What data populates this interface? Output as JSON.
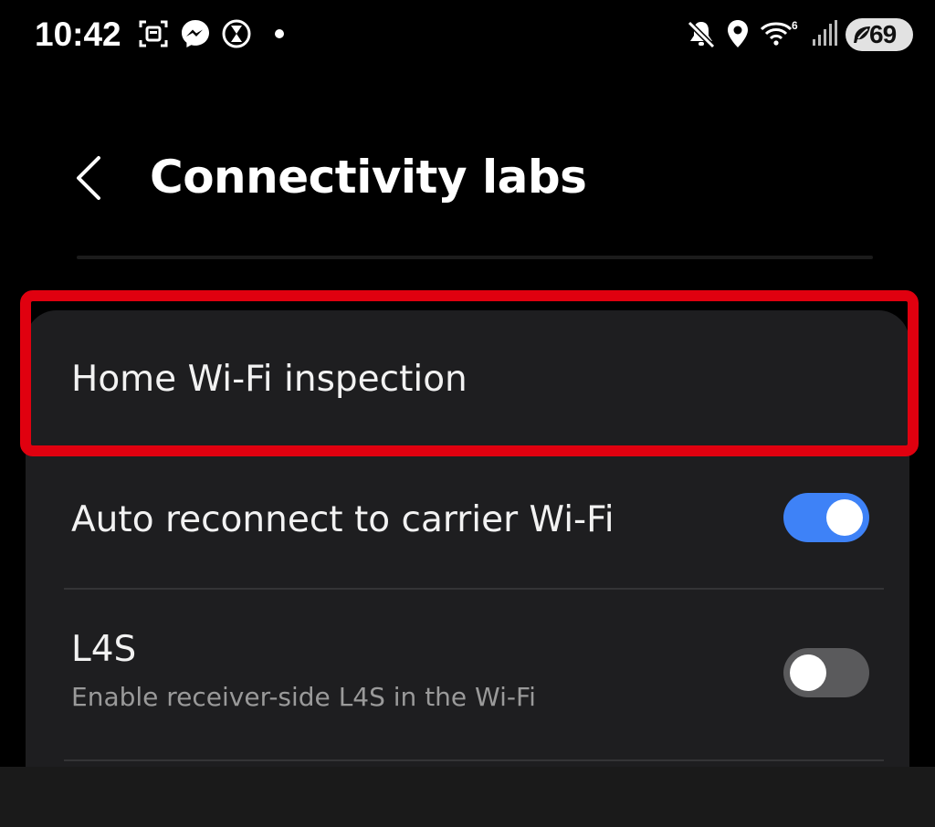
{
  "status_bar": {
    "time": "10:42",
    "icons": [
      "screenshot-icon",
      "messenger-icon",
      "timer-icon",
      "notification-dot",
      "mute-icon",
      "location-icon",
      "wifi-icon",
      "signal-icon",
      "battery-saver-icon"
    ],
    "battery_level": "69"
  },
  "header": {
    "back_icon": "chevron-left-icon",
    "title": "Connectivity labs"
  },
  "settings": {
    "items": [
      {
        "label": "Home Wi-Fi inspection"
      },
      {
        "label": "Auto reconnect to carrier Wi-Fi",
        "toggle": "on"
      },
      {
        "label": "L4S",
        "sublabel": "Enable receiver-side L4S in the Wi-Fi",
        "toggle": "off"
      }
    ]
  },
  "colors": {
    "background": "#000000",
    "card": "#1e1e20",
    "toggle_on": "#3e82f7",
    "toggle_off": "#5a5a5c",
    "highlight": "#e0000f"
  }
}
